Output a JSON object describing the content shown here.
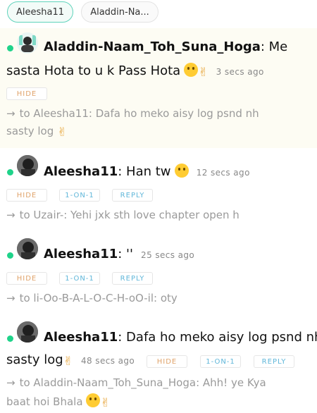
{
  "tabs": [
    "Aleesha11",
    "Aladdin-Na..."
  ],
  "messages": [
    {
      "sender": "Aladdin-Naam_Toh_Suna_Hoga",
      "text_line1": "Me",
      "text_line2": "sasta Hota to u k Pass Hota",
      "time": "3 secs ago",
      "buttons": [
        "HIDE"
      ],
      "reply_to": "to Aleesha11: Dafa ho meko aisy log psnd nh",
      "reply_to_line2": "sasty log"
    },
    {
      "sender": "Aleesha11",
      "text_line1": "Han tw",
      "time": "12 secs ago",
      "buttons": [
        "HIDE",
        "1-ON-1",
        "REPLY"
      ],
      "reply_to": "to Uzair-: Yehi jxk sth love chapter open h"
    },
    {
      "sender": "Aleesha11",
      "text_line1": "''",
      "time": "25 secs ago",
      "buttons": [
        "HIDE",
        "1-ON-1",
        "REPLY"
      ],
      "reply_to": "to li-Oo-B-A-L-O-C-H-oO-il: oty"
    },
    {
      "sender": "Aleesha11",
      "text_line1": "Dafa ho meko aisy log psnd nh",
      "text_line2": "sasty log",
      "time": "48 secs ago",
      "buttons": [
        "HIDE",
        "1-ON-1",
        "REPLY"
      ],
      "reply_to": "to Aladdin-Naam_Toh_Suna_Hoga: Ahh! ye Kya",
      "reply_to_line2": "baat hoi Bhala"
    }
  ],
  "icons": {
    "arrow": "→",
    "online": "online-dot-icon"
  },
  "colors": {
    "accent": "#5fd3bb",
    "online": "#1fd38a",
    "hide": "#e0a36a",
    "action": "#5fb6d9",
    "highlight_bg": "#fdfcf3"
  }
}
